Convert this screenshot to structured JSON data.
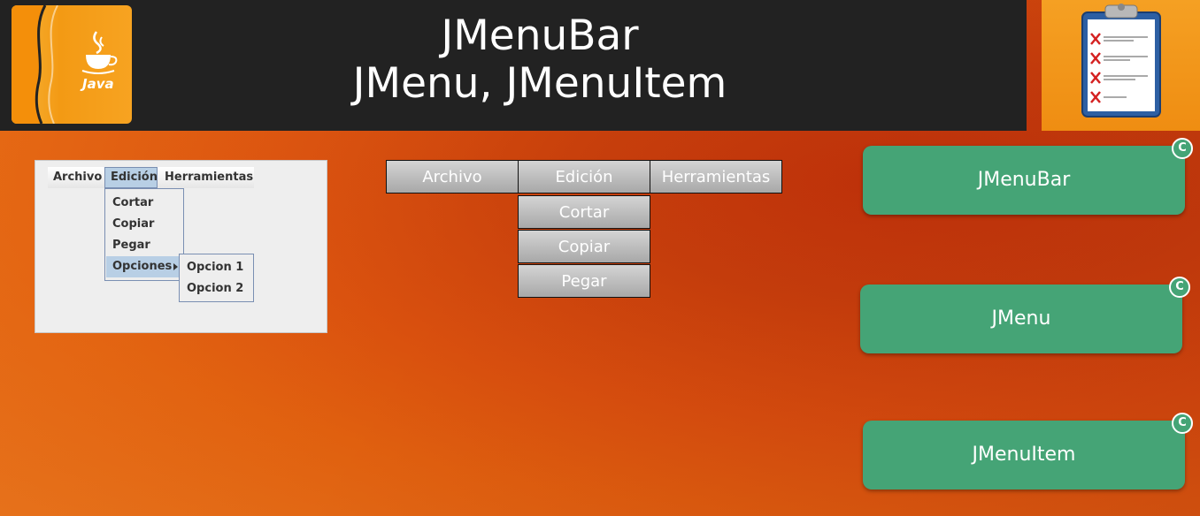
{
  "header": {
    "title_line1": "JMenuBar",
    "title_line2": "JMenu, JMenuItem",
    "logo_text": "Java"
  },
  "swing_example": {
    "menus": [
      "Archivo",
      "Edición",
      "Herramientas"
    ],
    "selected_menu": "Edición",
    "items": [
      "Cortar",
      "Copiar",
      "Pegar",
      "Opciones"
    ],
    "selected_item": "Opciones",
    "submenu_items": [
      "Opcion 1",
      "Opcion 2"
    ]
  },
  "diagram": {
    "menus": [
      "Archivo",
      "Edición",
      "Herramientas"
    ],
    "items": [
      "Cortar",
      "Copiar",
      "Pegar"
    ]
  },
  "buttons": [
    {
      "label": "JMenuBar",
      "badge": "C"
    },
    {
      "label": "JMenu",
      "badge": "C"
    },
    {
      "label": "JMenuItem",
      "badge": "C"
    }
  ],
  "colors": {
    "header_bg": "#222222",
    "button_green": "#45a476",
    "swing_selection": "#b8cfe5"
  }
}
